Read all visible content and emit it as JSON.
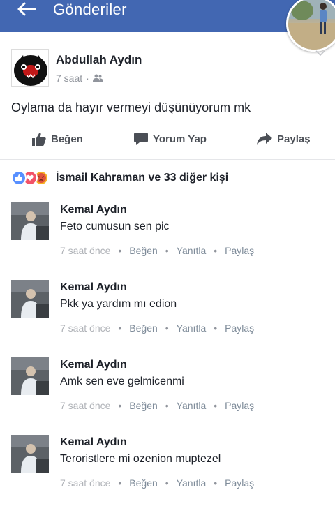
{
  "header": {
    "title": "Gönderiler",
    "background": "#4267b2"
  },
  "post": {
    "author": "Abdullah Aydın",
    "time": "7 saat",
    "privacy_icon": "friends-icon",
    "text": "Oylama da hayır vermeyi düşünüyorum mk",
    "actions": {
      "like": "Beğen",
      "comment": "Yorum Yap",
      "share": "Paylaş"
    }
  },
  "reactions": {
    "icons": [
      "like-icon",
      "love-icon",
      "angry-icon"
    ],
    "summary": "İsmail Kahraman ve 33 diğer kişi"
  },
  "comments": [
    {
      "name": "Kemal Aydın",
      "text": "Feto cumusun sen pic",
      "time": "7 saat önce",
      "like": "Beğen",
      "reply": "Yanıtla",
      "share": "Paylaş"
    },
    {
      "name": "Kemal Aydın",
      "text": "Pkk ya yardım mı edion",
      "time": "7 saat önce",
      "like": "Beğen",
      "reply": "Yanıtla",
      "share": "Paylaş"
    },
    {
      "name": "Kemal Aydın",
      "text": "Amk sen eve gelmicenmi",
      "time": "7 saat önce",
      "like": "Beğen",
      "reply": "Yanıtla",
      "share": "Paylaş"
    },
    {
      "name": "Kemal Aydın",
      "text": "Teroristlere mi ozenion muptezel",
      "time": "7 saat önce",
      "like": "Beğen",
      "reply": "Yanıtla",
      "share": "Paylaş"
    }
  ]
}
